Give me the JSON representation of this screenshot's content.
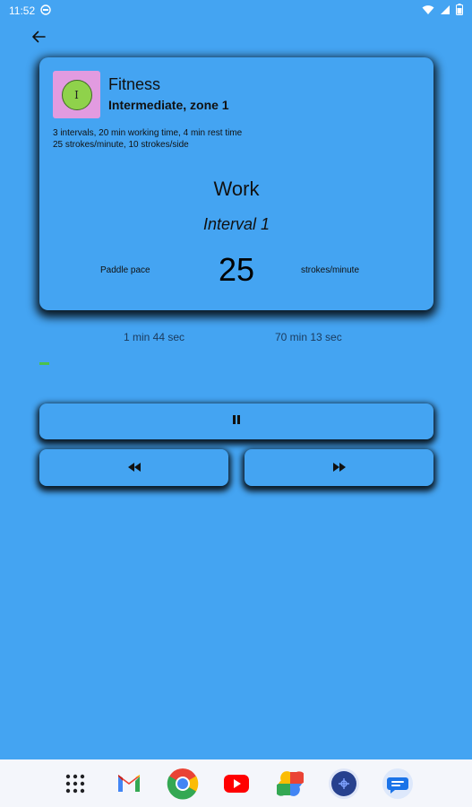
{
  "status_bar": {
    "time": "11:52",
    "icons": [
      "notification-icon",
      "wifi-icon",
      "signal-icon",
      "battery-icon"
    ]
  },
  "navigation": {
    "back_icon": "arrow-left-icon"
  },
  "program": {
    "name": "Fitness",
    "level": "Intermediate, zone 1",
    "summary_line1": "3 intervals, 20 min working time, 4 min rest time",
    "summary_line2": "25 strokes/minute, 10 strokes/side",
    "avatar_letter": "I"
  },
  "session": {
    "phase": "Work",
    "interval": "Interval 1",
    "pace_label": "Paddle pace",
    "pace_value": "25",
    "pace_unit": "strokes/minute",
    "interval_time": "1 min 44 sec",
    "total_time": "70 min 13 sec",
    "progress_fraction": 0.025
  },
  "controls": {
    "pause_icon": "pause-icon",
    "rewind_icon": "rewind-icon",
    "forward_icon": "fast-forward-icon"
  },
  "dock": {
    "apps": [
      "app-drawer-icon",
      "gmail-icon",
      "chrome-icon",
      "youtube-icon",
      "photos-icon",
      "assistant-icon",
      "messages-icon"
    ]
  },
  "colors": {
    "background": "#44a4f2",
    "avatar_bg": "#e29be0",
    "avatar_circle": "#8fd24b",
    "progress": "#4cc24c"
  }
}
